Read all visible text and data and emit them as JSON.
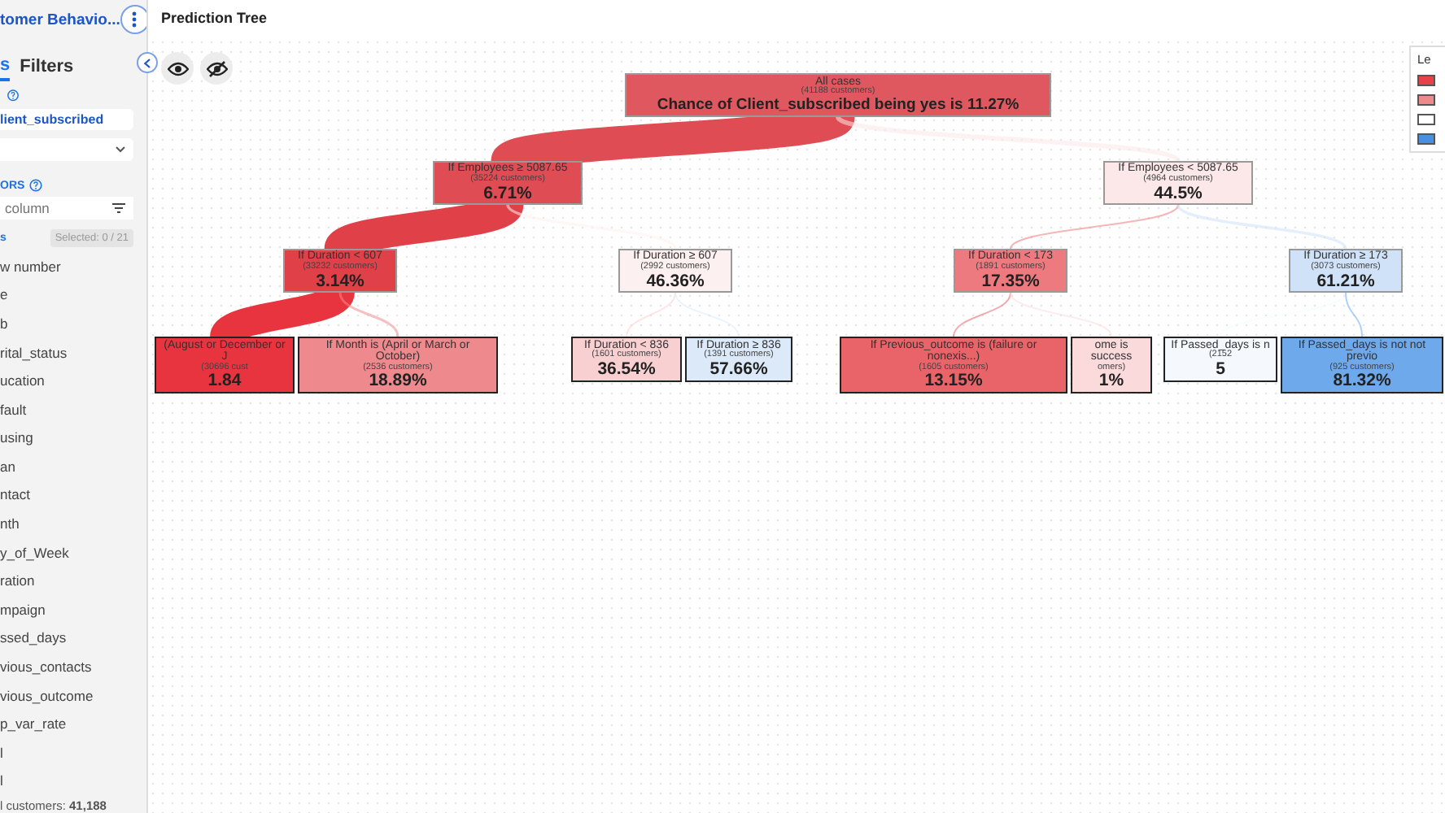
{
  "sidebar": {
    "title": "tomer Behavio...",
    "tabs": [
      {
        "label": "s",
        "selected": true
      },
      {
        "label": "Filters",
        "selected": false
      }
    ],
    "target_field": {
      "value": "lient_subscribed"
    },
    "section_label": "ORS",
    "search": {
      "placeholder": "column"
    },
    "list_label": "s",
    "selected_badge": "Selected: 0 / 21",
    "items": [
      "w number",
      "e",
      "b",
      "rital_status",
      "ucation",
      "fault",
      "using",
      "an",
      "ntact",
      "nth",
      "y_of_Week",
      "ration",
      "mpaign",
      "ssed_days",
      "vious_contacts",
      "vious_outcome",
      "p_var_rate",
      "l",
      "l"
    ],
    "footer": "l customers: **41,188**"
  },
  "main": {
    "title": "Prediction Tree"
  },
  "legend": {
    "title": "Le",
    "items": [
      {
        "color": "#e8414a"
      },
      {
        "color": "#ef8a8c"
      },
      {
        "color": "#ffffff"
      },
      {
        "color": "#4a90e2"
      }
    ]
  },
  "tree": {
    "root": {
      "condition": "All cases",
      "customers": "(41188 customers)",
      "percent": "Chance of Client_subscribed being yes is 11.27%",
      "color": "#e0585f",
      "children": [
        {
          "condition": "If Employees ≥ 5087.65",
          "customers": "(35224 customers)",
          "percent": "6.71%",
          "color": "#e04c54",
          "children": [
            {
              "condition": "If Duration < 607",
              "customers": "(33232 customers)",
              "percent": "3.14%",
              "color": "#e04048",
              "children": [
                {
                  "condition": "(August or December or J",
                  "customers": "(30696 cust",
                  "percent": "1.84",
                  "color": "#e8343e"
                },
                {
                  "condition": "If Month is (April or March or October)",
                  "customers": "(2536 customers)",
                  "percent": "18.89%",
                  "color": "#ee8a8d"
                }
              ]
            },
            {
              "condition": "If Duration ≥ 607",
              "customers": "(2992 customers)",
              "percent": "46.36%",
              "color": "#fdf0f0",
              "children": [
                {
                  "condition": "If Duration < 836",
                  "customers": "(1601 customers)",
                  "percent": "36.54%",
                  "color": "#f9d0d2"
                },
                {
                  "condition": "If Duration ≥ 836",
                  "customers": "(1391 customers)",
                  "percent": "57.66%",
                  "color": "#dce9f8"
                }
              ]
            }
          ]
        },
        {
          "condition": "If Employees < 5087.65",
          "customers": "(4964 customers)",
          "percent": "44.5%",
          "color": "#fce8e8",
          "children": [
            {
              "condition": "If Duration < 173",
              "customers": "(1891 customers)",
              "percent": "17.35%",
              "color": "#ec7a7e",
              "children": [
                {
                  "condition": "If Previous_outcome is (failure or nonexis...)",
                  "customers": "(1605 customers)",
                  "percent": "13.15%",
                  "color": "#e96468"
                },
                {
                  "condition": "ome is success",
                  "customers": "omers)",
                  "percent": "1%",
                  "color": "#fadadb"
                }
              ]
            },
            {
              "condition": "If Duration ≥ 173",
              "customers": "(3073 customers)",
              "percent": "61.21%",
              "color": "#cfe2f8",
              "children": [
                {
                  "condition": "If Passed_days is n",
                  "customers": "(2152",
                  "percent": "5",
                  "color": "#f5f9fe"
                },
                {
                  "condition": "If Passed_days is not not previo",
                  "customers": "(925 customers)",
                  "percent": "81.32%",
                  "color": "#6ea9ec"
                }
              ]
            }
          ]
        }
      ]
    }
  }
}
